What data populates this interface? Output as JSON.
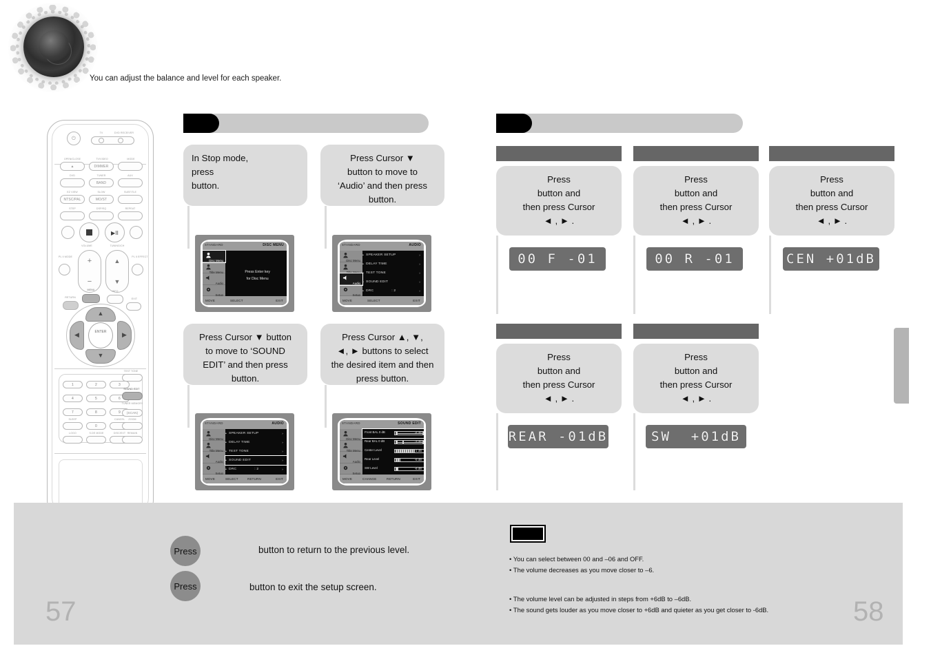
{
  "header": {
    "note": "You can adjust the balance and level for each speaker.",
    "speaker_icon": "speaker-cone-icon"
  },
  "pages": {
    "left": "57",
    "right": "58"
  },
  "remote": {
    "power_label": "power-icon",
    "device_labels": [
      "TV",
      "DVD RECEIVER"
    ],
    "rows": [
      {
        "labels": [
          "OPEN/CLOSE",
          "TV/VIDEO",
          "MODE"
        ],
        "keys": [
          "▲",
          "DIMMER",
          ""
        ]
      },
      {
        "labels": [
          "DVD",
          "TUNER",
          "AUX"
        ],
        "keys": [
          "",
          "BAND",
          ""
        ]
      },
      {
        "labels": [
          "EZ VIEW",
          "SLOW",
          "SUBTITLE"
        ],
        "keys": [
          "NTSC/PAL",
          "MO/ST",
          ""
        ]
      },
      {
        "labels": [
          "STEP",
          "DSP/EQ",
          "REPEAT"
        ],
        "keys": [
          "",
          "",
          ""
        ]
      }
    ],
    "transport": [
      "prev-track-icon",
      "stop-icon",
      "play-pause-icon",
      "next-track-icon"
    ],
    "volume_label": "VOLUME",
    "tuning_label": "TUNING/CH",
    "pl_mode_label": "PL II MODE",
    "pl_effect_label": "PL II EFFECT",
    "menu_label": "MENU",
    "info_label": "INFO",
    "return_label": "RETURN",
    "exit_label": "EXIT",
    "enter_label": "ENTER",
    "keypad": [
      "1",
      "2",
      "3",
      "4",
      "5",
      "6",
      "7",
      "8",
      "9",
      "0"
    ],
    "keypad_side": [
      "TEST TONE",
      "SOUND EDIT",
      "TUNER MEMORY",
      "ZOOM"
    ],
    "keypad_side_keys": [
      "",
      "",
      "(SCAN)",
      ""
    ],
    "bottom_labels": [
      "SLEEP",
      "CANCEL",
      "ZOOM",
      "LOGO",
      "S.DE MODE",
      "DISC/EXT",
      "REMAIN"
    ]
  },
  "left_column": {
    "title_bar": "",
    "steps": [
      {
        "text": "In Stop mode,\npress\nbutton.",
        "screen": {
          "mark": "STANDARD",
          "mode": "DISC MENU",
          "rail": [
            {
              "label": "Disc Menu",
              "icon": "person-icon",
              "selected": true
            },
            {
              "label": "Title Menu",
              "icon": "person-icon",
              "selected": false
            },
            {
              "label": "Audio",
              "icon": "speaker-icon",
              "selected": false
            },
            {
              "label": "Setup",
              "icon": "gear-icon",
              "selected": false
            }
          ],
          "center": "Press Enter key\nfor Disc Menu",
          "footer": [
            "MOVE",
            "SELECT",
            "EXIT"
          ]
        }
      },
      {
        "text": "Press Cursor ▼\nbutton to move to\n‘Audio’ and then press\nbutton.",
        "screen": {
          "mark": "STANDARD",
          "mode": "AUDIO",
          "rail": [
            {
              "label": "Disc Menu",
              "icon": "person-icon",
              "selected": false
            },
            {
              "label": "Title Menu",
              "icon": "person-icon",
              "selected": false
            },
            {
              "label": "Audio",
              "icon": "speaker-icon",
              "selected": true
            },
            {
              "label": "Setup",
              "icon": "gear-icon",
              "selected": false
            }
          ],
          "items": [
            {
              "label": "SPEAKER SETUP",
              "value": "",
              "highlight": false
            },
            {
              "label": "DELAY TIME",
              "value": "",
              "highlight": false
            },
            {
              "label": "TEST TONE",
              "value": "",
              "highlight": false
            },
            {
              "label": "SOUND EDIT",
              "value": "",
              "highlight": false
            },
            {
              "label": "DRC",
              "value": ": 2",
              "highlight": false
            }
          ],
          "footer": [
            "MOVE",
            "SELECT",
            "EXIT"
          ]
        }
      },
      {
        "text": "Press Cursor ▼ button\nto move to ‘SOUND\nEDIT’ and then press\nbutton.",
        "screen": {
          "mark": "STANDARD",
          "mode": "AUDIO",
          "rail": [
            {
              "label": "Disc Menu",
              "icon": "person-icon",
              "selected": false
            },
            {
              "label": "Title Menu",
              "icon": "person-icon",
              "selected": false
            },
            {
              "label": "Audio",
              "icon": "speaker-icon",
              "selected": false
            },
            {
              "label": "Setup",
              "icon": "gear-icon",
              "selected": false
            }
          ],
          "items": [
            {
              "label": "SPEAKER SETUP",
              "value": "",
              "highlight": false
            },
            {
              "label": "DELAY TIME",
              "value": "",
              "highlight": false
            },
            {
              "label": "TEST TONE",
              "value": "",
              "highlight": false
            },
            {
              "label": "SOUND EDIT",
              "value": "",
              "highlight": true
            },
            {
              "label": "DRC",
              "value": ": 2",
              "highlight": false
            }
          ],
          "footer": [
            "MOVE",
            "SELECT",
            "RETURN",
            "EXIT"
          ]
        }
      },
      {
        "text": "Press Cursor ▲, ▼,\n◄, ► buttons to select\nthe desired item and then\npress        button.",
        "screen": {
          "mark": "STANDARD",
          "mode": "SOUND EDIT",
          "rail": [
            {
              "label": "Disc Menu",
              "icon": "person-icon",
              "selected": false
            },
            {
              "label": "Title Menu",
              "icon": "person-icon",
              "selected": false
            },
            {
              "label": "Audio",
              "icon": "speaker-icon",
              "selected": false
            },
            {
              "label": "Setup",
              "icon": "gear-icon",
              "selected": false
            }
          ],
          "rows": [
            {
              "label": "Front BAL  0 dB",
              "value": "-6 dB",
              "fill": 0,
              "marker": 2,
              "highlight": true
            },
            {
              "label": "Rear BAL  0 dB",
              "value": "-3 dB",
              "fill": 0,
              "marker": 22,
              "highlight": false
            },
            {
              "label": "Center Level",
              "value": "+1 dB",
              "fill": 62,
              "marker": -1,
              "highlight": false
            },
            {
              "label": "Rear Level",
              "value": "-5 dB",
              "fill": 16,
              "marker": -1,
              "highlight": false
            },
            {
              "label": "SW  Level",
              "value": "-6 dB",
              "fill": 8,
              "marker": -1,
              "highlight": false
            }
          ],
          "footer": [
            "MOVE",
            "CHANGE",
            "RETURN",
            "EXIT"
          ]
        }
      }
    ]
  },
  "right_column": {
    "title_bar": "",
    "cards": [
      {
        "header": "",
        "text": "Press\n        button and\nthen press Cursor\n◄ , ► .",
        "lcd": "00 F -01"
      },
      {
        "header": "",
        "text": "Press\n        button and\nthen press Cursor\n◄ , ► .",
        "lcd": "00 R -01"
      },
      {
        "header": "",
        "text": "Press\n        button and\nthen press Cursor\n◄ , ► .",
        "lcd": "CEN +01dB"
      },
      {
        "header": "",
        "text": "Press\n        button and\nthen press Cursor\n◄ , ► .",
        "lcd": "REAR -01dB"
      },
      {
        "header": "",
        "text": "Press\n        button and\nthen press Cursor\n◄ , ► .",
        "lcd": "SW  +01dB"
      }
    ]
  },
  "footer": {
    "left_rows": [
      {
        "pill": "Press",
        "text": "button to return to the previous level."
      },
      {
        "pill": "Press",
        "text": "button to exit the setup screen."
      }
    ],
    "note_label": "",
    "notes_group_1": [
      "You can select between 00 and –06 and OFF.",
      "The volume decreases as you move closer to –6."
    ],
    "notes_group_2": [
      "The volume level can be adjusted in steps from +6dB to –6dB.",
      "The sound gets louder as you move closer to +6dB and quieter as you get closer to -6dB."
    ]
  },
  "colors": {
    "bubble_gray": "#dcdcdc",
    "panel_gray": "#d8d8d8",
    "header_dark": "#666666",
    "lcd_bg": "#6e6e6e",
    "pill_gray": "#8c8c8c"
  }
}
